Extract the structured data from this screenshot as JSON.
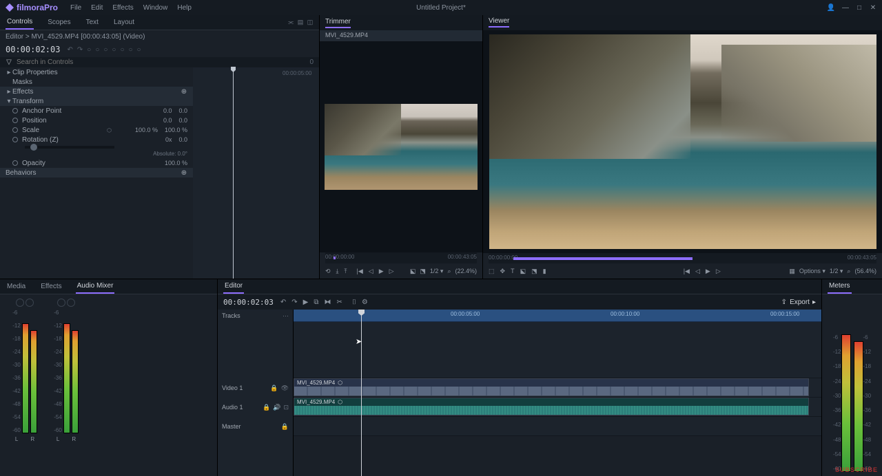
{
  "app": {
    "name": "filmoraPro",
    "project_title": "Untitled Project*"
  },
  "menu": {
    "file": "File",
    "edit": "Edit",
    "effects": "Effects",
    "window": "Window",
    "help": "Help"
  },
  "controls": {
    "tabs": {
      "controls": "Controls",
      "scopes": "Scopes",
      "text": "Text",
      "layout": "Layout"
    },
    "breadcrumb": "Editor > MVI_4529.MP4 [00:00:43:05] (Video)",
    "timecode": "00:00:02:03",
    "search_placeholder": "Search in Controls",
    "mini_time": "00:00:05:00",
    "groups": {
      "clip_properties": "Clip Properties",
      "masks": "Masks",
      "effects": "Effects",
      "transform": "Transform",
      "behaviors": "Behaviors"
    },
    "props": {
      "anchor": {
        "label": "Anchor Point",
        "x": "0.0",
        "y": "0.0"
      },
      "position": {
        "label": "Position",
        "x": "0.0",
        "y": "0.0"
      },
      "scale": {
        "label": "Scale",
        "x": "100.0 %",
        "y": "100.0 %"
      },
      "rotation": {
        "label": "Rotation (Z)",
        "turns": "0x",
        "deg": "0.0"
      },
      "rotation_abs": "Absolute: 0.0°",
      "opacity": {
        "label": "Opacity",
        "val": "100.0 %"
      }
    }
  },
  "trimmer": {
    "title": "Trimmer",
    "clip": "MVI_4529.MP4",
    "start": "00:00:00:00",
    "end": "00:00:43:05",
    "page": "1/2 ▾",
    "zoom": "(22.4%)"
  },
  "viewer": {
    "title": "Viewer",
    "start": "00:00:00:00",
    "end": "00:00:43:05",
    "options": "Options ▾",
    "page": "1/2 ▾",
    "zoom": "(56.4%)"
  },
  "mixer": {
    "tabs": {
      "media": "Media",
      "effects": "Effects",
      "audio_mixer": "Audio Mixer"
    },
    "labels": {
      "L": "L",
      "R": "R"
    },
    "db": [
      "-6",
      "-12",
      "-18",
      "-24",
      "-30",
      "-36",
      "-42",
      "-48",
      "-54",
      "-60"
    ]
  },
  "editor": {
    "title": "Editor",
    "timecode": "00:00:02:03",
    "export": "Export",
    "tracks_label": "Tracks",
    "video1": "Video 1",
    "audio1": "Audio 1",
    "master": "Master",
    "clip_name": "MVI_4529.MP4",
    "ruler": [
      "00:00:05:00",
      "00:00:10:00",
      "00:00:15:00"
    ]
  },
  "meters": {
    "title": "Meters",
    "db": [
      "-6",
      "-12",
      "-18",
      "-24",
      "-30",
      "-36",
      "-42",
      "-48",
      "-54",
      "-60"
    ]
  },
  "icons": {
    "undo": "↶",
    "redo": "↷",
    "play": "▶",
    "prev": "◀",
    "next": "▶",
    "first": "|◀",
    "last": "▶|",
    "loop": "⟲",
    "gear": "⚙",
    "search": "⌕",
    "filter": "▽",
    "maximize": "□",
    "close": "✕",
    "minimize": "—",
    "user": "👤",
    "keyframe": "◇",
    "link": "⬡",
    "eye": "👁",
    "lock": "🔒",
    "speaker": "🔊",
    "menu": "⋯",
    "razor": "✂",
    "snap": "⧉",
    "marker": "⬓",
    "in": "[",
    "out": "]",
    "arrow": "➤",
    "step_back": "◁",
    "step_fwd": "▷",
    "chevron": "▸"
  }
}
